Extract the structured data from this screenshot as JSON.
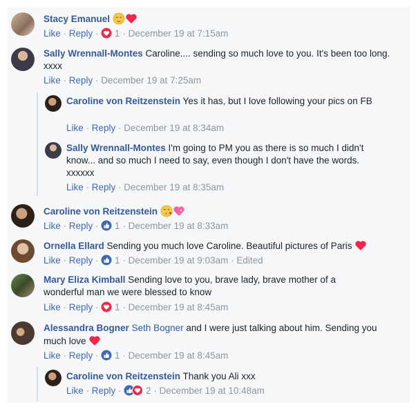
{
  "comments": [
    {
      "name": "Stacy Emanuel",
      "text": "",
      "emoji": [
        "relieved-face",
        "red-heart"
      ],
      "like": "Like",
      "reply": "Reply",
      "reaction": "love",
      "count": "1",
      "date": "December 19 at 7:15am",
      "edited": ""
    },
    {
      "name": "Sally Wrennall-Montes",
      "text": " Caroline.... sending so much love to you. It's been too long. xxxx",
      "emoji": [],
      "like": "Like",
      "reply": "Reply",
      "reaction": "",
      "count": "",
      "date": "December 19 at 7:25am",
      "edited": ""
    },
    {
      "name": "Caroline von Reitzenstein",
      "text": " Yes it has, but I love following your pics on FB",
      "emoji": [],
      "like": "Like",
      "reply": "Reply",
      "reaction": "",
      "count": "",
      "date": "December 19 at 8:34am",
      "edited": ""
    },
    {
      "name": "Sally Wrennall-Montes",
      "text": " I'm going to PM you as there is so much I didn't know... and so much I need to say, even though I don't have the words. xxxxxx",
      "emoji": [],
      "like": "Like",
      "reply": "Reply",
      "reaction": "",
      "count": "",
      "date": "December 19 at 8:35am",
      "edited": ""
    },
    {
      "name": "Caroline von Reitzenstein",
      "text": "",
      "emoji": [
        "face-blowing-kiss",
        "sparkling-heart"
      ],
      "like": "Like",
      "reply": "Reply",
      "reaction": "like",
      "count": "1",
      "date": "December 19 at 8:33am",
      "edited": ""
    },
    {
      "name": "Ornella Ellard",
      "text": " Sending you much love Caroline. Beautiful pictures of Paris",
      "emoji": [
        "red-heart"
      ],
      "like": "Like",
      "reply": "Reply",
      "reaction": "like",
      "count": "1",
      "date": "December 19 at 9:03am",
      "edited": "Edited"
    },
    {
      "name": "Mary Eliza Kimball",
      "text": " Sending love to you, brave lady, brave mother of a wonderful man we were blessed to know",
      "emoji": [],
      "like": "Like",
      "reply": "Reply",
      "reaction": "love",
      "count": "1",
      "date": "December 19 at 8:45am",
      "edited": ""
    },
    {
      "name": "Alessandra Bogner",
      "mention": "Seth Bogner",
      "text": " and I were just talking about him. Sending you much love",
      "emoji": [
        "red-heart"
      ],
      "like": "Like",
      "reply": "Reply",
      "reaction": "like",
      "count": "1",
      "date": "December 19 at 8:45am",
      "edited": ""
    },
    {
      "name": "Caroline von Reitzenstein",
      "text": " Thank you Ali xxx",
      "emoji": [],
      "like": "Like",
      "reply": "Reply",
      "reaction": "like-love",
      "count": "2",
      "date": "December 19 at 10:48am",
      "edited": ""
    }
  ],
  "colors": {
    "link": "#365899",
    "meta": "#90949c",
    "like_blue": "#4267b2",
    "love_red": "#f0284a",
    "bg": "#f6f7f9"
  }
}
